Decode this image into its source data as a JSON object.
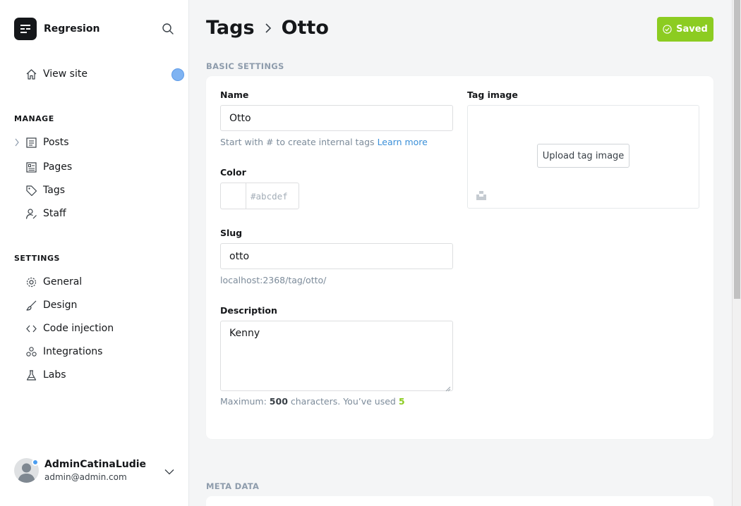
{
  "app": {
    "name": "Regresion"
  },
  "sidebar": {
    "view_site": "View site",
    "manage_title": "MANAGE",
    "manage_items": [
      {
        "label": "Posts",
        "icon": "posts-icon"
      },
      {
        "label": "Pages",
        "icon": "pages-icon"
      },
      {
        "label": "Tags",
        "icon": "tag-icon"
      },
      {
        "label": "Staff",
        "icon": "staff-icon"
      }
    ],
    "settings_title": "SETTINGS",
    "settings_items": [
      {
        "label": "General",
        "icon": "gear-icon"
      },
      {
        "label": "Design",
        "icon": "brush-icon"
      },
      {
        "label": "Code injection",
        "icon": "code-icon"
      },
      {
        "label": "Integrations",
        "icon": "integrations-icon"
      },
      {
        "label": "Labs",
        "icon": "flask-icon"
      }
    ],
    "user": {
      "name": "AdminCatinaLudie",
      "email": "admin@admin.com"
    }
  },
  "header": {
    "breadcrumb_root": "Tags",
    "breadcrumb_current": "Otto",
    "save_label": "Saved"
  },
  "form": {
    "section_basic": "BASIC SETTINGS",
    "name_label": "Name",
    "name_value": "Otto",
    "name_hint": "Start with # to create internal tags",
    "name_hint_link": "Learn more",
    "color_label": "Color",
    "color_placeholder": "#abcdef",
    "slug_label": "Slug",
    "slug_value": "otto",
    "slug_url": "localhost:2368/tag/otto/",
    "description_label": "Description",
    "description_value": "Kenny",
    "desc_hint_prefix": "Maximum:",
    "desc_hint_max": "500",
    "desc_hint_mid": "characters. You’ve used",
    "desc_hint_used": "5",
    "tag_image_label": "Tag image",
    "upload_label": "Upload tag image",
    "section_meta": "META DATA"
  },
  "colors": {
    "accent_green": "#8ccc21",
    "link_blue": "#3a8fd8"
  }
}
